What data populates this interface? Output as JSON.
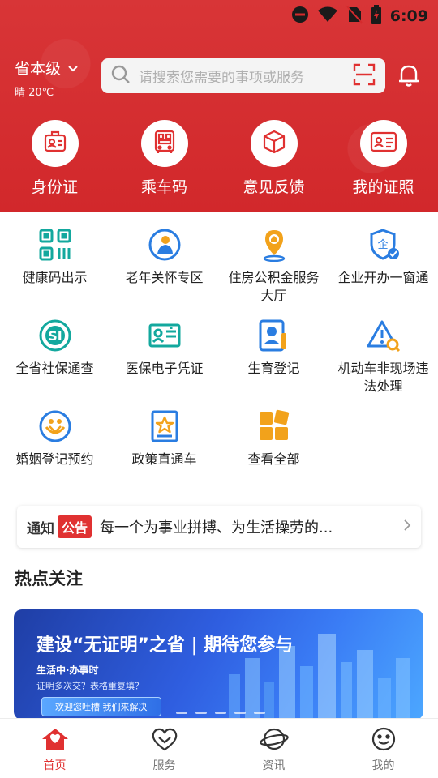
{
  "status_bar": {
    "time": "6:09"
  },
  "location": {
    "name": "省本级",
    "weather": "晴 20℃"
  },
  "search": {
    "placeholder": "请搜索您需要的事项或服务"
  },
  "quick_actions": [
    {
      "label": "身份证",
      "icon": "id-badge-icon"
    },
    {
      "label": "乘车码",
      "icon": "bus-qr-icon"
    },
    {
      "label": "意见反馈",
      "icon": "feedback-box-icon"
    },
    {
      "label": "我的证照",
      "icon": "license-card-icon"
    }
  ],
  "services": [
    {
      "label": "健康码出示",
      "icon": "health-code-icon"
    },
    {
      "label": "老年关怀专区",
      "icon": "elderly-care-icon"
    },
    {
      "label": "住房公积金服务大厅",
      "icon": "housing-fund-icon"
    },
    {
      "label": "企业开办一窗通",
      "icon": "enterprise-shield-icon"
    },
    {
      "label": "全省社保通查",
      "icon": "social-security-icon"
    },
    {
      "label": "医保电子凭证",
      "icon": "medical-card-icon"
    },
    {
      "label": "生育登记",
      "icon": "birth-registration-icon"
    },
    {
      "label": "机动车非现场违法处理",
      "icon": "vehicle-violation-icon"
    },
    {
      "label": "婚姻登记预约",
      "icon": "marriage-registration-icon"
    },
    {
      "label": "政策直通车",
      "icon": "policy-express-icon"
    },
    {
      "label": "查看全部",
      "icon": "view-all-grid-icon"
    }
  ],
  "notice": {
    "tag_left": "通知",
    "tag_right": "公告",
    "text": "每一个为事业拼搏、为生活操劳的..."
  },
  "hot_section": {
    "title": "热点关注"
  },
  "banner": {
    "title": "建设“无证明”之省 | 期待您参与",
    "subtitle": "生活中·办事时",
    "line2": "证明多次交？表格重复填？",
    "button": "欢迎您吐槽 我们来解决"
  },
  "bottom_nav": [
    {
      "label": "首页",
      "icon": "home-icon",
      "active": true
    },
    {
      "label": "服务",
      "icon": "heart-service-icon",
      "active": false
    },
    {
      "label": "资讯",
      "icon": "news-planet-icon",
      "active": false
    },
    {
      "label": "我的",
      "icon": "smiley-profile-icon",
      "active": false
    }
  ],
  "colors": {
    "brand_red": "#d52a2c",
    "teal": "#13a89e",
    "blue": "#2a7de1",
    "orange": "#f2a21b"
  }
}
